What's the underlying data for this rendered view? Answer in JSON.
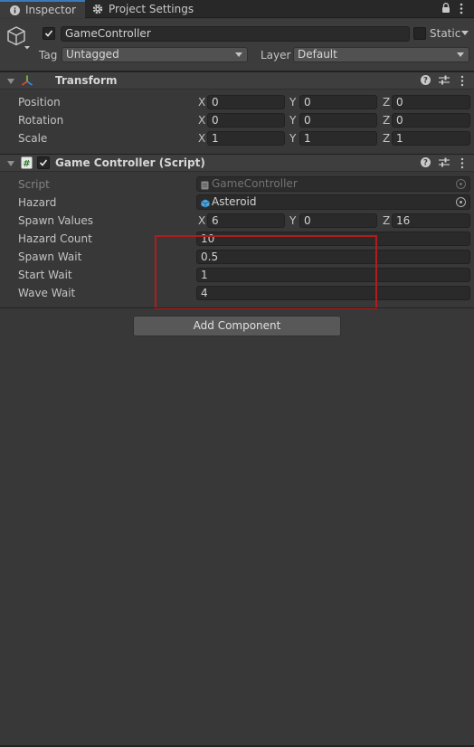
{
  "tabs": {
    "inspector": "Inspector",
    "project_settings": "Project Settings"
  },
  "header": {
    "name": "GameController",
    "static_label": "Static",
    "tag_label": "Tag",
    "tag_value": "Untagged",
    "layer_label": "Layer",
    "layer_value": "Default"
  },
  "transform": {
    "title": "Transform",
    "rows": [
      {
        "label": "Position",
        "x": "0",
        "y": "0",
        "z": "0"
      },
      {
        "label": "Rotation",
        "x": "0",
        "y": "0",
        "z": "0"
      },
      {
        "label": "Scale",
        "x": "1",
        "y": "1",
        "z": "1"
      }
    ]
  },
  "axis": {
    "x": "X",
    "y": "Y",
    "z": "Z"
  },
  "script_component": {
    "title": "Game Controller (Script)",
    "script_label": "Script",
    "script_value": "GameController",
    "hazard_label": "Hazard",
    "hazard_value": "Asteroid",
    "spawn_values_label": "Spawn Values",
    "spawn_values": {
      "x": "6",
      "y": "0",
      "z": "16"
    },
    "hazard_count_label": "Hazard Count",
    "hazard_count": "10",
    "spawn_wait_label": "Spawn Wait",
    "spawn_wait": "0.5",
    "start_wait_label": "Start Wait",
    "start_wait": "1",
    "wave_wait_label": "Wave Wait",
    "wave_wait": "4"
  },
  "add_component": "Add Component",
  "colors": {
    "background": "#383838",
    "accent": "#3a79bb",
    "highlight": "#b21c1c"
  }
}
